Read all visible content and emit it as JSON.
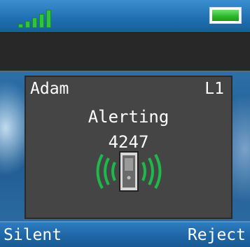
{
  "status": {
    "signal_icon": "signal-strength-icon",
    "signal_level": 5,
    "battery_icon": "battery-full-icon",
    "battery_level": 1.0,
    "signal_color": "#2fc63c",
    "battery_color": "#2dbb2d"
  },
  "call": {
    "caller_name": "Adam",
    "line": "L1",
    "state": "Alerting",
    "number": "4247",
    "icon": "ringing-handset-icon",
    "icon_color": "#1fb84a"
  },
  "softkeys": {
    "left_label": "Silent",
    "right_label": "Reject"
  }
}
